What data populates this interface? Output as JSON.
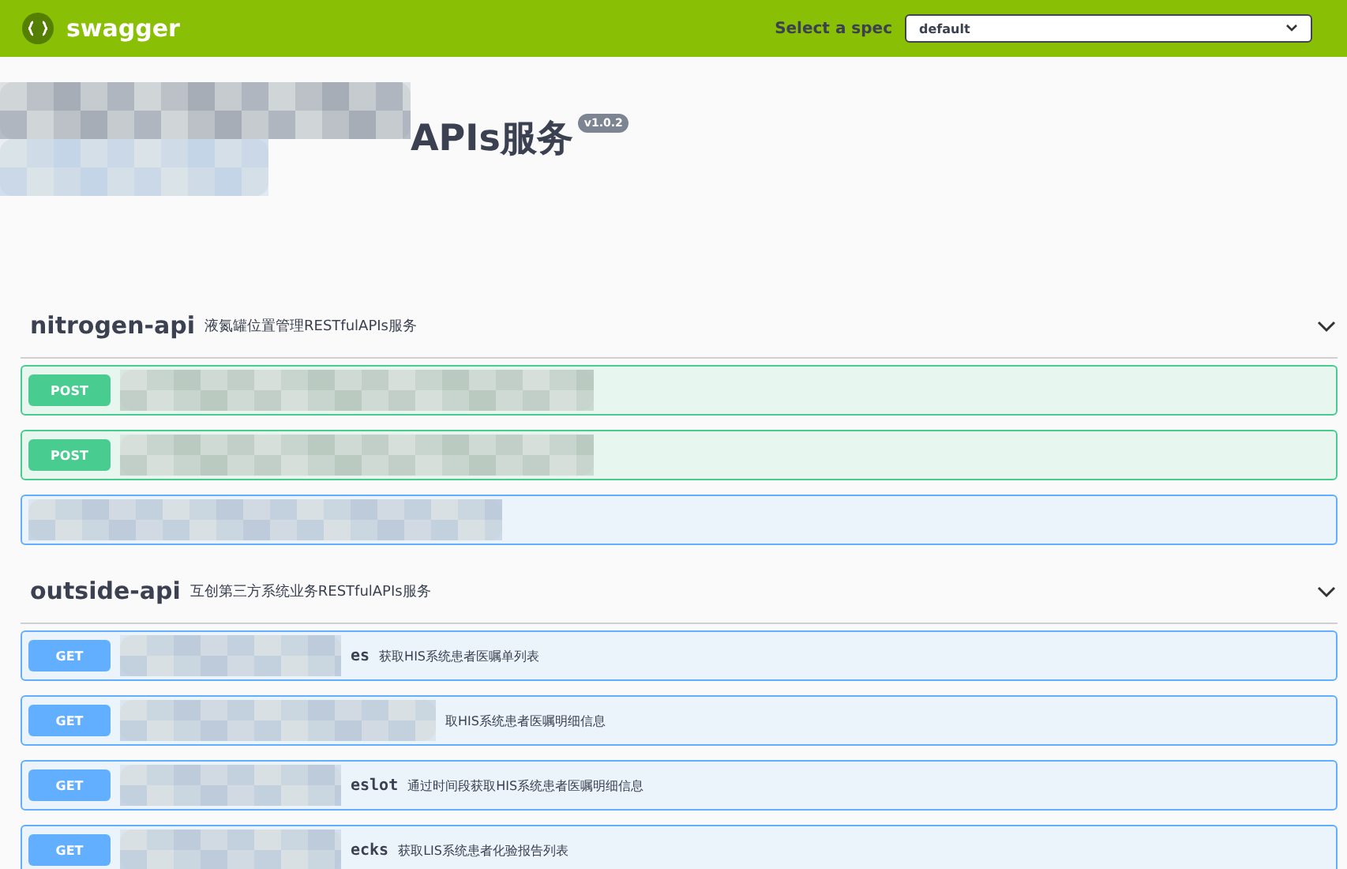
{
  "topbar": {
    "logo": "swagger",
    "spec_label": "Select a spec",
    "spec_value": "default"
  },
  "info": {
    "title": "APIs服务",
    "version": "v1.0.2"
  },
  "sections": [
    {
      "name": "nitrogen-api",
      "description": "液氮罐位置管理RESTfulAPIs服务",
      "expanded": true,
      "operations": [
        {
          "kind": "post",
          "method": "POST"
        },
        {
          "kind": "post",
          "method": "POST"
        },
        {
          "kind": "get"
        }
      ]
    },
    {
      "name": "outside-api",
      "description": "互创第三方系统业务RESTfulAPIs服务",
      "expanded": true,
      "operations": [
        {
          "kind": "get",
          "method": "GET",
          "path": "es",
          "summary": "获取HIS系统患者医嘱单列表"
        },
        {
          "kind": "get",
          "method": "GET",
          "summary": "取HIS系统患者医嘱明细信息"
        },
        {
          "kind": "get",
          "method": "GET",
          "path": "eslot",
          "summary": "通过时间段获取HIS系统患者医嘱明细信息"
        },
        {
          "kind": "get",
          "method": "GET",
          "path": "ecks",
          "summary": "获取LIS系统患者化验报告列表"
        }
      ]
    }
  ]
}
